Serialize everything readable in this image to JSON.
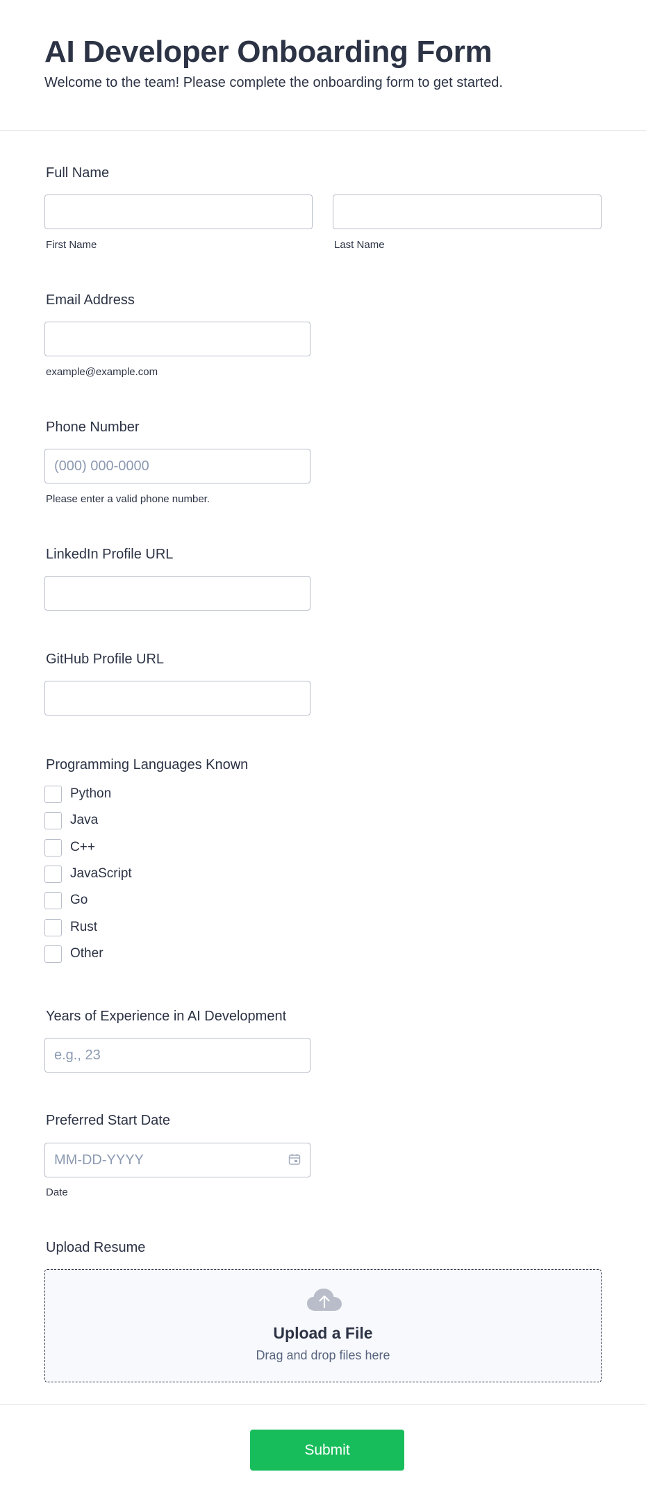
{
  "header": {
    "title": "AI Developer Onboarding Form",
    "subtitle": "Welcome to the team! Please complete the onboarding form to get started."
  },
  "full_name": {
    "label": "Full Name",
    "first": {
      "sublabel": "First Name",
      "value": "",
      "placeholder": ""
    },
    "last": {
      "sublabel": "Last Name",
      "value": "",
      "placeholder": ""
    }
  },
  "email": {
    "label": "Email Address",
    "value": "",
    "placeholder": "",
    "sublabel": "example@example.com"
  },
  "phone": {
    "label": "Phone Number",
    "value": "",
    "placeholder": "(000) 000-0000",
    "sublabel": "Please enter a valid phone number."
  },
  "linkedin": {
    "label": "LinkedIn Profile URL",
    "value": "",
    "placeholder": ""
  },
  "github": {
    "label": "GitHub Profile URL",
    "value": "",
    "placeholder": ""
  },
  "languages": {
    "label": "Programming Languages Known",
    "options": [
      "Python",
      "Java",
      "C++",
      "JavaScript",
      "Go",
      "Rust",
      "Other"
    ],
    "checked": [
      false,
      false,
      false,
      false,
      false,
      false,
      false
    ]
  },
  "experience": {
    "label": "Years of Experience in AI Development",
    "value": "",
    "placeholder": "e.g., 23"
  },
  "start_date": {
    "label": "Preferred Start Date",
    "value": "",
    "placeholder": "MM-DD-YYYY",
    "sublabel": "Date",
    "icon": "calendar-icon"
  },
  "resume": {
    "label": "Upload Resume",
    "title": "Upload a File",
    "subtitle": "Drag and drop files here",
    "icon": "cloud-upload-icon"
  },
  "submit": {
    "label": "Submit"
  },
  "colors": {
    "text": "#2c3345",
    "placeholder": "#8c9ab1",
    "input_border": "#b8bdc9",
    "submit_bg": "#18bd5b",
    "upload_bg": "#f8f9fc"
  }
}
